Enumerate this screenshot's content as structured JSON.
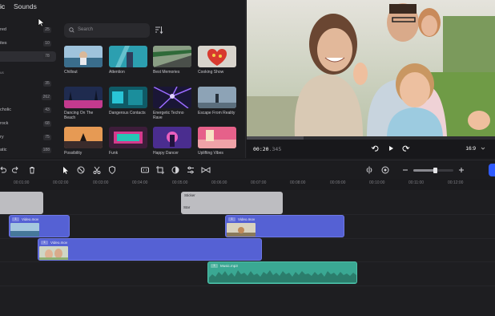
{
  "library": {
    "tabs": [
      {
        "label": "ic",
        "active": true
      },
      {
        "label": "Sounds",
        "active": false
      }
    ],
    "search_placeholder": "Search",
    "categories": [
      {
        "label": "red",
        "count": "25"
      },
      {
        "label": "ites",
        "count": "10"
      },
      {
        "label": "",
        "count": "78",
        "selected": true
      },
      {
        "label": "us",
        "count": ""
      },
      {
        "label": "",
        "count": "35"
      },
      {
        "label": "",
        "count": "262"
      },
      {
        "label": "cholic",
        "count": "43"
      },
      {
        "label": "rock",
        "count": "68"
      },
      {
        "label": "ry",
        "count": "75"
      },
      {
        "label": "atic",
        "count": "188"
      }
    ],
    "tracks": [
      {
        "title": "Chillout"
      },
      {
        "title": "Attention"
      },
      {
        "title": "Best Memories"
      },
      {
        "title": "Cooking Show"
      },
      {
        "title": "Dancing On The Beach"
      },
      {
        "title": "Dangerous Contacts"
      },
      {
        "title": "Energetic Techno Rave"
      },
      {
        "title": "Escape From Reality"
      },
      {
        "title": "Possibility"
      },
      {
        "title": "Funk"
      },
      {
        "title": "Happy Dancer"
      },
      {
        "title": "Uplifting Vibes"
      }
    ]
  },
  "preview": {
    "timecode_main": "00:20",
    "timecode_frac": ".345",
    "aspect_ratio": "16:9",
    "progress": 0.23
  },
  "timeline": {
    "zoom": 0.55,
    "ruler_labels": [
      "00:01:00",
      "00:02:00",
      "00:03:00",
      "00:04:00",
      "00:05:00",
      "00:06:00",
      "00:07:00",
      "00:08:00",
      "00:09:00",
      "00:10:00",
      "00:11:00",
      "00:12:00"
    ],
    "clips": {
      "sticker_title": "Sticker",
      "sticker_sub": "Star",
      "video_label": "Video.mov",
      "music_label": "Music.mp3",
      "tag_label": "1"
    }
  },
  "colors": {
    "accent": "#2f5bff",
    "video_clip": "#5561d4",
    "audio_clip": "#3aa893",
    "sticker_clip": "#bdbdc1"
  },
  "icons": [
    "search-icon",
    "sort-icon",
    "undo-icon",
    "redo-icon",
    "delete-icon",
    "select-icon",
    "disable-icon",
    "scissors-icon",
    "shield-icon",
    "caption-icon",
    "crop-icon",
    "color-icon",
    "adjust-icon",
    "transition-icon",
    "split-view-icon",
    "magnet-icon",
    "minus-icon",
    "plus-icon",
    "play-icon",
    "rewind-icon",
    "forward-icon",
    "chevron-down-icon",
    "cursor-icon"
  ]
}
